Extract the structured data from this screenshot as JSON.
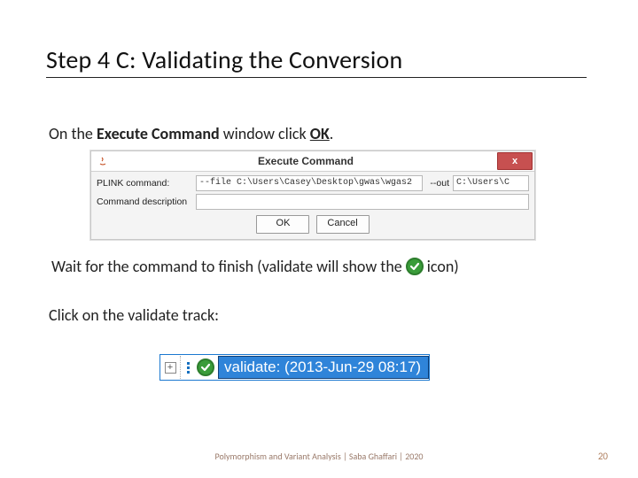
{
  "title": "Step 4 C: Validating the Conversion",
  "line1": {
    "prefix": "On the ",
    "bold": "Execute Command",
    "mid": " window click ",
    "underline": "OK",
    "suffix": "."
  },
  "dialog": {
    "window_title": "Execute Command",
    "close": "x",
    "plink_label": "PLINK command:",
    "plink_value": "--file C:\\Users\\Casey\\Desktop\\gwas\\wgas2",
    "out_label": "--out",
    "out_value": "C:\\Users\\C",
    "desc_label": "Command description",
    "desc_value": "",
    "ok": "OK",
    "cancel": "Cancel"
  },
  "line2": {
    "before": "Wait for the command to finish (validate will show the",
    "after": " icon)"
  },
  "line3": "Click on the validate track:",
  "track": {
    "expand": "+",
    "label": "validate: (2013-Jun-29 08:17)"
  },
  "footer": "Polymorphism and Variant Analysis | Saba Ghaffari | 2020",
  "page": "20"
}
